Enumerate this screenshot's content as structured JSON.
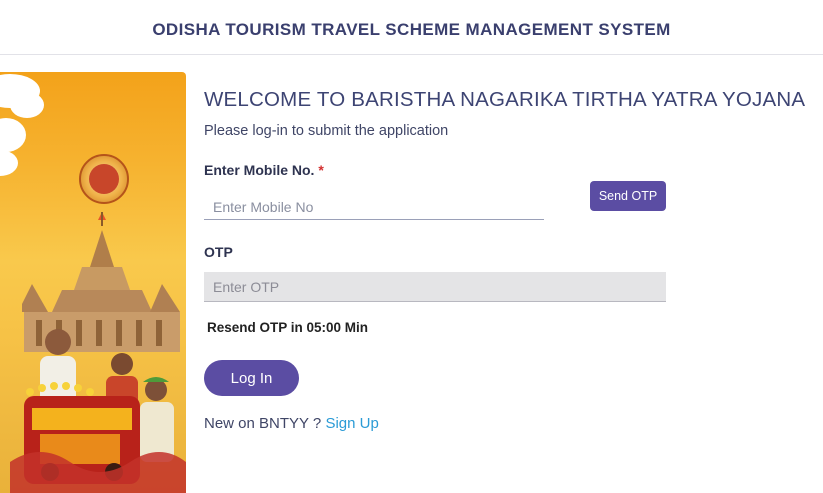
{
  "header": {
    "title": "ODISHA TOURISM TRAVEL SCHEME MANAGEMENT SYSTEM"
  },
  "main": {
    "welcome": "WELCOME TO BARISTHA NAGARIKA TIRTHA YATRA YOJANA",
    "subtitle": "Please log-in to submit the application",
    "mobile": {
      "label": "Enter Mobile No.",
      "required_mark": "*",
      "placeholder": "Enter Mobile No",
      "value": ""
    },
    "send_otp_label": "Send OTP",
    "otp": {
      "label": "OTP",
      "placeholder": "Enter OTP",
      "value": ""
    },
    "resend_text": "Resend OTP in 05:00 Min",
    "login_label": "Log In",
    "signup": {
      "prompt": "New on BNTYY ?",
      "link_label": "Sign Up"
    }
  },
  "colors": {
    "primary_button": "#5b4da3",
    "header_text": "#3a3f6e",
    "link": "#2b9bd6",
    "required": "#d32f2f"
  },
  "icons": {
    "logo": "scheme-emblem",
    "banner": "temple-pilgrims-train-illustration"
  }
}
